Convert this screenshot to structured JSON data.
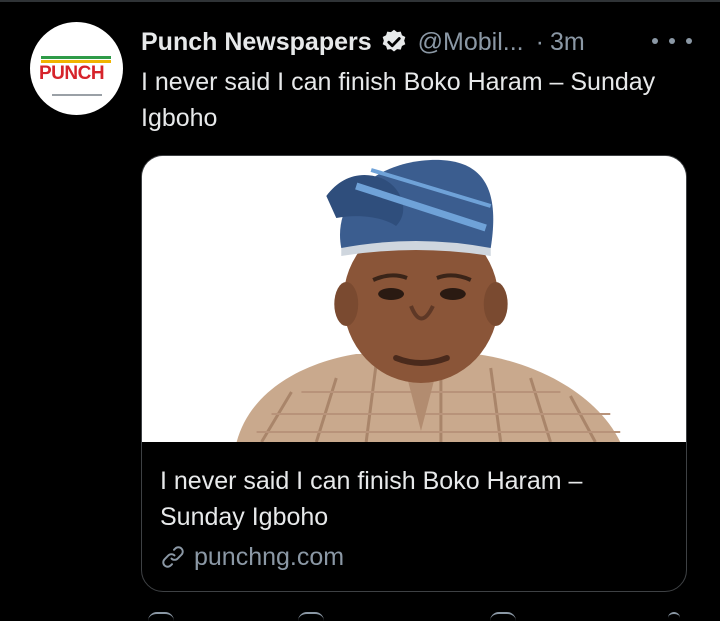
{
  "tweet": {
    "author_name": "Punch Newspapers",
    "handle": "@Mobil...",
    "separator": "·",
    "timestamp": "3m",
    "text": "I never said I can finish Boko Haram – Sunday Igboho",
    "verified_icon": "verified-badge-icon",
    "more_icon": "more-options-icon"
  },
  "avatar": {
    "logo_text": "PUNCH",
    "brand_color": "#d6242b"
  },
  "card": {
    "title": "I never said I can finish Boko Haram – Sunday Igboho",
    "domain": "punchng.com",
    "link_icon": "link-icon",
    "image": "portrait of man wearing blue fila cap"
  },
  "colors": {
    "background": "#000000",
    "text_primary": "#e7e9ea",
    "text_secondary": "#8b98a5",
    "card_border": "#3e4144"
  }
}
